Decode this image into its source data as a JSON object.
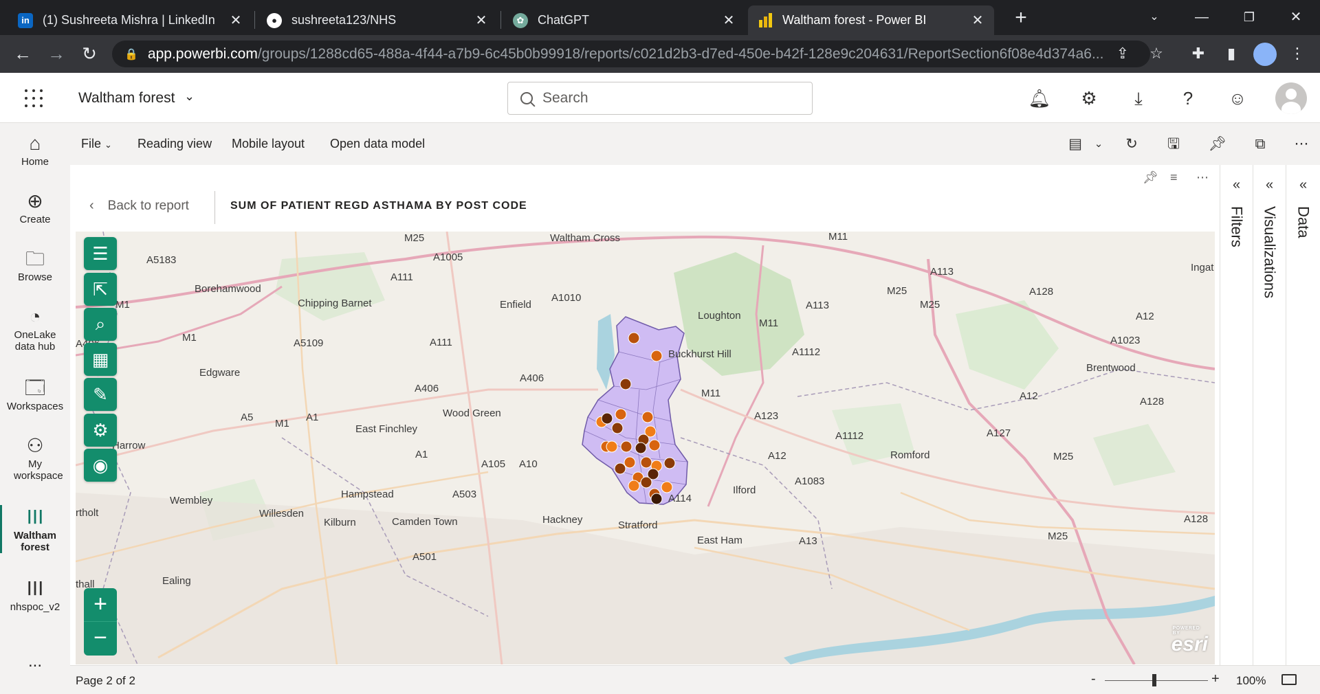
{
  "browser": {
    "tabs": [
      {
        "icon": "linkedin-icon",
        "title": "(1) Sushreeta Mishra | LinkedIn"
      },
      {
        "icon": "github-icon",
        "title": "sushreeta123/NHS"
      },
      {
        "icon": "chatgpt-icon",
        "title": "ChatGPT"
      },
      {
        "icon": "powerbi-icon",
        "title": "Waltham forest - Power BI"
      }
    ],
    "active_tab": 3,
    "url_host": "app.powerbi.com",
    "url_path": "/groups/1288cd65-488a-4f44-a7b9-6c45b0b99918/reports/c021d2b3-d7ed-450e-b42f-128e9c204631/ReportSection6f08e4d374a6..."
  },
  "header": {
    "workspace_title": "Waltham forest",
    "search_placeholder": "Search"
  },
  "leftnav": {
    "items": [
      {
        "label": "Home",
        "icon": "home-icon"
      },
      {
        "label": "Create",
        "icon": "plus-circle-icon"
      },
      {
        "label": "Browse",
        "icon": "folder-icon"
      },
      {
        "label": "OneLake data hub",
        "icon": "onelake-icon"
      },
      {
        "label": "Workspaces",
        "icon": "workspaces-icon"
      },
      {
        "label": "My workspace",
        "icon": "my-workspace-icon"
      },
      {
        "label": "Waltham forest",
        "icon": "report-icon",
        "active": true
      },
      {
        "label": "nhspoc_v2",
        "icon": "report-icon"
      }
    ],
    "more": "..."
  },
  "commandbar": {
    "file": "File",
    "reading_view": "Reading view",
    "mobile_layout": "Mobile layout",
    "open_data_model": "Open data model"
  },
  "report": {
    "back_label": "Back to report",
    "visual_title": "SUM OF PATIENT REGD ASTHAMA BY POST CODE",
    "map_labels": [
      "Waltham Cross",
      "A5183",
      "Borehamwood",
      "Chipping Barnet",
      "Enfield",
      "A1005",
      "A111",
      "A1010",
      "M25",
      "M11",
      "A113",
      "A128",
      "Ingat",
      "Loughton",
      "M11",
      "A113",
      "M25",
      "M25",
      "A12",
      "A1023",
      "Buckhurst Hill",
      "A1112",
      "Brentwood",
      "A5109",
      "A111",
      "M1",
      "M1",
      "Edgware",
      "A406",
      "A406",
      "M11",
      "A12",
      "A128",
      "Wood Green",
      "A5",
      "M1",
      "A1",
      "East Finchley",
      "A123",
      "A1112",
      "A127",
      "Harrow",
      "A1",
      "A105",
      "A10",
      "A12",
      "Romford",
      "M25",
      "A1083",
      "Ilford",
      "Hampstead",
      "A503",
      "Wembley",
      "Willesden",
      "Kilburn",
      "Camden Town",
      "Hackney",
      "Stratford",
      "A114",
      "East Ham",
      "A13",
      "A128",
      "M25",
      "A501",
      "Ealing",
      "rtholt",
      "thall",
      "A406"
    ],
    "legend": "esri",
    "legend_small": "POWERED BY"
  },
  "panes": {
    "filters": "Filters",
    "visualizations": "Visualizations",
    "data": "Data"
  },
  "status": {
    "page": "Page 2 of 2",
    "zoom": "100%"
  },
  "colors": {
    "accent": "#117865",
    "map_tool": "#138d6c",
    "region_fill": "#c9b3f5",
    "dot_light": "#f07d19",
    "dot_mid": "#b8510c",
    "dot_dark": "#6a2a08"
  }
}
